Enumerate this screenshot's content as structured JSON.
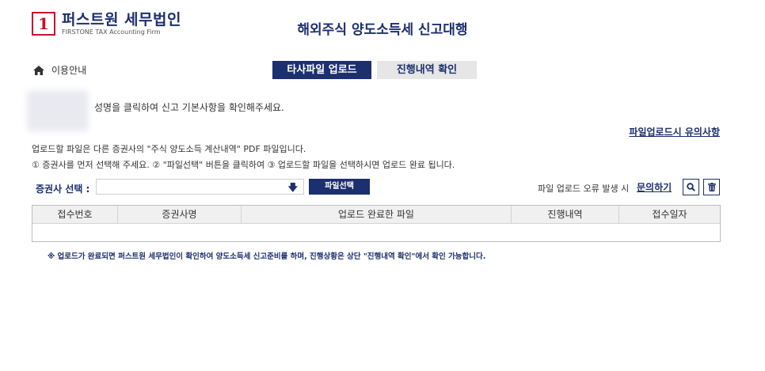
{
  "header": {
    "logo_mark": "1",
    "logo_name": "퍼스트원 세무법인",
    "logo_sub": "FIRSTONE TAX Accounting Firm",
    "title": "해외주식 양도소득세 신고대행"
  },
  "nav": {
    "guide_label": "이용안내",
    "tabs": [
      {
        "label": "타사파일 업로드",
        "active": true
      },
      {
        "label": "진행내역 확인",
        "active": false
      }
    ]
  },
  "user": {
    "info_text": "성명을 클릭하여 신고 기본사항을 확인해주세요."
  },
  "upload": {
    "caution_link": "파일업로드시 유의사항",
    "instruction_1": "업로드할 파일은 다른 증권사의 \"주식 양도소득 계산내역\" PDF 파일입니다.",
    "instruction_2": "① 증권사를 먼저 선택해 주세요. ② \"파일선택\" 버튼을 클릭하여 ③ 업로드할 파일을 선택하시면 업로드 완료 됩니다.",
    "broker_label": "증권사 선택 :",
    "broker_value": "",
    "file_button": "파일선택",
    "error_text": "파일 업로드 오류 발생 시",
    "inquiry_link": "문의하기"
  },
  "table": {
    "columns": [
      "접수번호",
      "증권사명",
      "업로드 완료한 파일",
      "진행내역",
      "접수일자"
    ],
    "rows": []
  },
  "footer_note": "※ 업로드가 완료되면 퍼스트원 세무법인이 확인하여 양도소득세 신고준비를 하며, 진행상황은 상단 \"진행내역 확인\"에서 확인 가능합니다.",
  "colors": {
    "brand_navy": "#1c2f6e",
    "brand_red": "#c8102e",
    "tab_inactive_bg": "#e6e6e6"
  }
}
